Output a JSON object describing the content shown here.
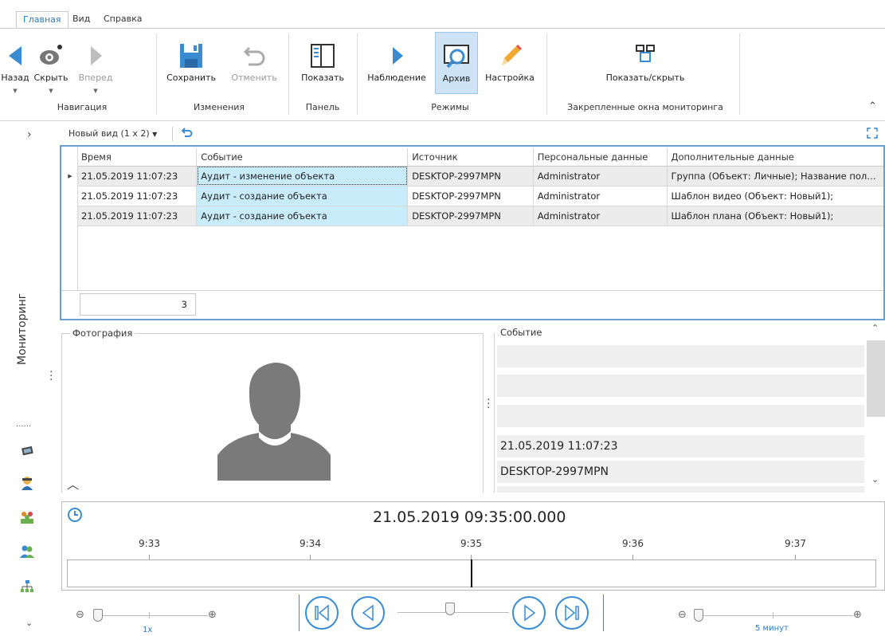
{
  "tabs": [
    {
      "label": "Главная",
      "active": true
    },
    {
      "label": "Вид",
      "active": false
    },
    {
      "label": "Справка",
      "active": false
    }
  ],
  "ribbon": {
    "buttons": {
      "back": "Назад",
      "hide": "Скрыть",
      "forward": "Вперед",
      "save": "Сохранить",
      "undo": "Отменить",
      "show": "Показать",
      "observe": "Наблюдение",
      "archive": "Архив",
      "settings": "Настройка",
      "toggle_pinned": "Показать/скрыть"
    },
    "groups": {
      "navigation": "Навигация",
      "changes": "Изменения",
      "panel": "Панель",
      "modes": "Режимы",
      "pinned": "Закрепленные окна мониторинга"
    }
  },
  "sidebar": {
    "label": "Мониторинг",
    "dots": "......"
  },
  "view": {
    "name": "Новый вид (1 x 2)"
  },
  "grid": {
    "columns": [
      "Время",
      "Событие",
      "Источник",
      "Персональные данные",
      "Дополнительные данные"
    ],
    "rows": [
      [
        "21.05.2019 11:07:23",
        "Аудит - изменение объекта",
        "DESKTOP-2997MPN",
        "Administrator",
        "Группа (Объект: Личные); Название пол…"
      ],
      [
        "21.05.2019 11:07:23",
        "Аудит - создание объекта",
        "DESKTOP-2997MPN",
        "Administrator",
        "Шаблон видео (Объект: Новый1);"
      ],
      [
        "21.05.2019 11:07:23",
        "Аудит - создание объекта",
        "DESKTOP-2997MPN",
        "Administrator",
        "Шаблон плана (Объект: Новый1);"
      ]
    ],
    "count": "3"
  },
  "photo_panel": {
    "title": "Фотография"
  },
  "event_panel": {
    "title": "Событие",
    "rows": [
      "",
      "",
      "",
      "21.05.2019 11:07:23",
      "DESKTOP-2997MPN"
    ]
  },
  "timeline": {
    "current": "21.05.2019 09:35:00.000",
    "ticks": [
      "9:33",
      "9:34",
      "9:35",
      "9:36",
      "9:37"
    ],
    "speed": "1x",
    "scale": "5 минут"
  },
  "colors": {
    "accent": "#3b8bd0",
    "selected_cell": "#c9ecfa",
    "ribbon_selected": "#cde4f7",
    "pencil": "#f0a830"
  }
}
